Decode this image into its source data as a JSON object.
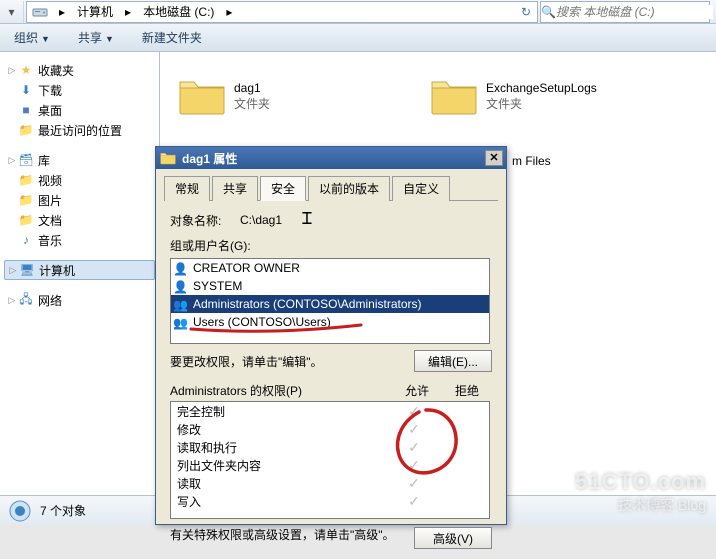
{
  "address": {
    "part1": "计算机",
    "part2": "本地磁盘 (C:)"
  },
  "search": {
    "placeholder": "搜索 本地磁盘 (C:)"
  },
  "toolbar": {
    "organize": "组织",
    "share": "共享",
    "newfolder": "新建文件夹"
  },
  "tree": {
    "fav": "收藏夹",
    "downloads": "下载",
    "desktop": "桌面",
    "recent": "最近访问的位置",
    "lib": "库",
    "video": "视频",
    "pictures": "图片",
    "docs": "文档",
    "music": "音乐",
    "computer": "计算机",
    "network": "网络"
  },
  "items": {
    "dag1_name": "dag1",
    "dag1_type": "文件夹",
    "esl_name": "ExchangeSetupLogs",
    "esl_type": "文件夹",
    "pf_name": "m Files"
  },
  "statusbar": {
    "count": "7 个对象"
  },
  "dialog": {
    "title": "dag1 属性",
    "tabs": {
      "general": "常规",
      "sharing": "共享",
      "security": "安全",
      "prev": "以前的版本",
      "custom": "自定义"
    },
    "obj_label": "对象名称:",
    "obj_value": "C:\\dag1",
    "groups_label": "组或用户名(G):",
    "groups": {
      "creator": "CREATOR OWNER",
      "system": "SYSTEM",
      "admins": "Administrators (CONTOSO\\Administrators)",
      "users": "Users (CONTOSO\\Users)"
    },
    "edit_text": "要更改权限，请单击\"编辑\"。",
    "edit_btn": "编辑(E)...",
    "perm_label": "Administrators 的权限(P)",
    "allow": "允许",
    "deny": "拒绝",
    "perms": {
      "full": "完全控制",
      "modify": "修改",
      "rex": "读取和执行",
      "list": "列出文件夹内容",
      "read": "读取",
      "write": "写入"
    },
    "adv_text": "有关特殊权限或高级设置，请单击\"高级\"。",
    "adv_btn": "高级(V)"
  },
  "watermark": {
    "l1": "51CTO.com",
    "l2": "技术博客   Blog"
  }
}
